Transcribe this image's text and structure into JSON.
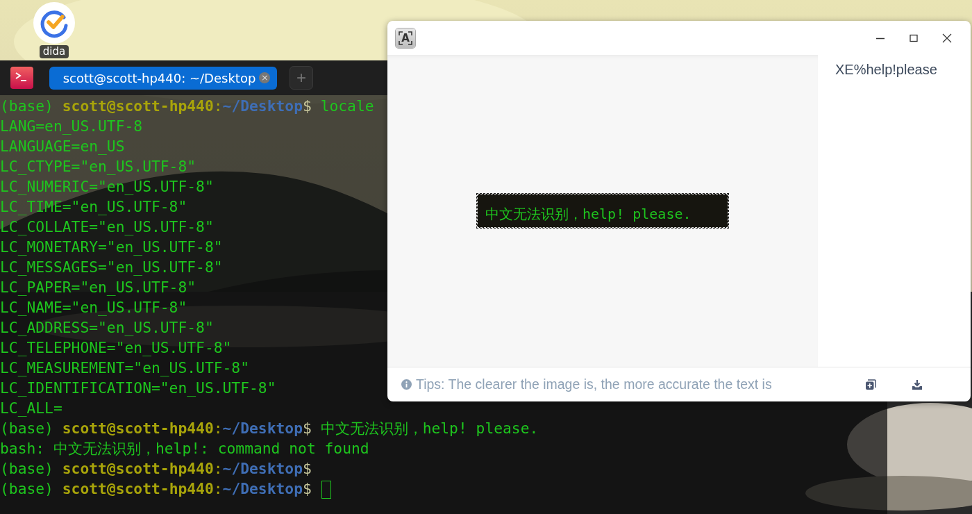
{
  "desktop": {
    "icons": [
      {
        "label": "dida"
      }
    ]
  },
  "terminal": {
    "tabs": [
      {
        "label": "scott@scott-hp440: ~/Desktop",
        "close": "×",
        "selected": true
      }
    ],
    "new_tab": "+",
    "lines": [
      {
        "kind": "prompt",
        "env": "(base)",
        "user": "scott@scott-hp440",
        "sep": ":",
        "path": "~/Desktop",
        "symbol": "$",
        "command": "locale",
        "cursor": false
      },
      {
        "kind": "output",
        "text": "LANG=en_US.UTF-8"
      },
      {
        "kind": "output",
        "text": "LANGUAGE=en_US"
      },
      {
        "kind": "output",
        "text": "LC_CTYPE=\"en_US.UTF-8\""
      },
      {
        "kind": "output",
        "text": "LC_NUMERIC=\"en_US.UTF-8\""
      },
      {
        "kind": "output",
        "text": "LC_TIME=\"en_US.UTF-8\""
      },
      {
        "kind": "output",
        "text": "LC_COLLATE=\"en_US.UTF-8\""
      },
      {
        "kind": "output",
        "text": "LC_MONETARY=\"en_US.UTF-8\""
      },
      {
        "kind": "output",
        "text": "LC_MESSAGES=\"en_US.UTF-8\""
      },
      {
        "kind": "output",
        "text": "LC_PAPER=\"en_US.UTF-8\""
      },
      {
        "kind": "output",
        "text": "LC_NAME=\"en_US.UTF-8\""
      },
      {
        "kind": "output",
        "text": "LC_ADDRESS=\"en_US.UTF-8\""
      },
      {
        "kind": "output",
        "text": "LC_TELEPHONE=\"en_US.UTF-8\""
      },
      {
        "kind": "output",
        "text": "LC_MEASUREMENT=\"en_US.UTF-8\""
      },
      {
        "kind": "output",
        "text": "LC_IDENTIFICATION=\"en_US.UTF-8\""
      },
      {
        "kind": "output",
        "text": "LC_ALL="
      },
      {
        "kind": "prompt",
        "env": "(base)",
        "user": "scott@scott-hp440",
        "sep": ":",
        "path": "~/Desktop",
        "symbol": "$",
        "command": "中文无法识别，help! please.",
        "cursor": false
      },
      {
        "kind": "output",
        "text": "bash: 中文无法识别，help!: command not found"
      },
      {
        "kind": "prompt",
        "env": "(base)",
        "user": "scott@scott-hp440",
        "sep": ":",
        "path": "~/Desktop",
        "symbol": "$",
        "cursor": false
      },
      {
        "kind": "prompt",
        "env": "(base)",
        "user": "scott@scott-hp440",
        "sep": ":",
        "path": "~/Desktop",
        "symbol": "$",
        "cursor": true
      }
    ]
  },
  "ocr_window": {
    "logo": "A",
    "preview_text": "中文无法识别，help! please.",
    "result_text": "XE%help!please",
    "tip": "Tips: The clearer the image is, the more accurate the text is"
  }
}
